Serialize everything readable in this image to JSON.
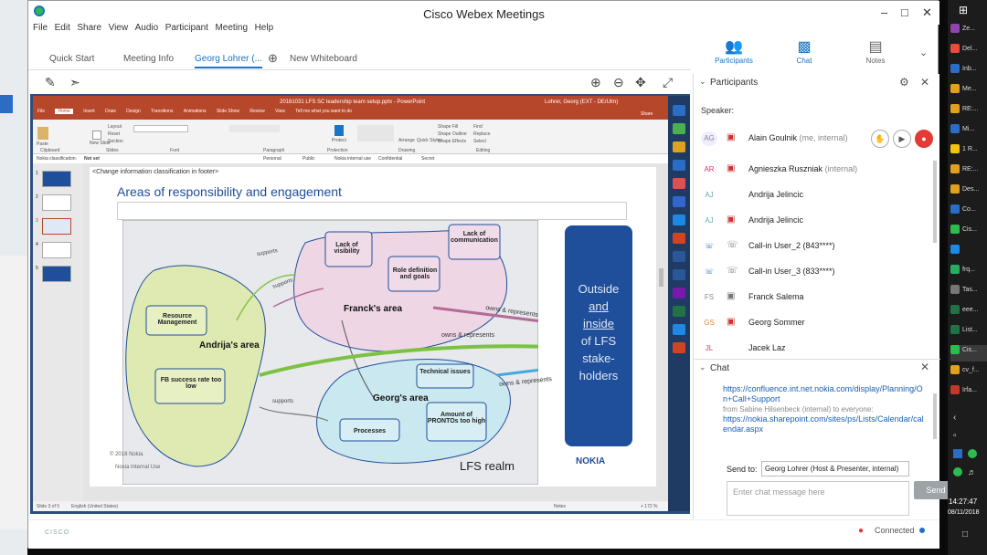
{
  "window": {
    "title": "Cisco Webex Meetings"
  },
  "menu": [
    "File",
    "Edit",
    "Share",
    "View",
    "Audio",
    "Participant",
    "Meeting",
    "Help"
  ],
  "tabs": {
    "quick_start": "Quick Start",
    "meeting_info": "Meeting Info",
    "active": "Georg Lohrer (...",
    "new_whiteboard": "New Whiteboard"
  },
  "right_tabs": {
    "participants": "Participants",
    "chat": "Chat",
    "notes": "Notes"
  },
  "ppt": {
    "title": "20181031 LFS SC leadership team setup.pptx - PowerPoint",
    "user": "Lohrer, Georg (EXT - DE/Ulm)",
    "menu": [
      "File",
      "Home",
      "Insert",
      "Draw",
      "Design",
      "Transitions",
      "Animations",
      "Slide Show",
      "Review",
      "View",
      "Tell me what you want to do"
    ],
    "share": "Share",
    "ribbon_groups": [
      "Clipboard",
      "Slides",
      "Font",
      "Paragraph",
      "Protection",
      "Drawing",
      "Editing"
    ],
    "ribbon_labels": {
      "paste": "Paste",
      "new_slide": "New Slide",
      "layout": "Layout",
      "reset": "Reset",
      "section": "Section",
      "protect": "Protect",
      "arrange": "Arrange",
      "quick_styles": "Quick Styles",
      "shape_fill": "Shape Fill",
      "shape_outline": "Shape Outline",
      "shape_effects": "Shape Effects",
      "find": "Find",
      "replace": "Replace",
      "select": "Select"
    },
    "classification_label": "Nokia classification:",
    "classification_value": "Not set",
    "classifications": [
      "Personal",
      "Public",
      "Nokia internal use",
      "Confidential",
      "Secret"
    ],
    "status_left": "Slide 3 of 5",
    "status_lang": "English (United States)",
    "status_notes": "Notes",
    "zoom": "+ 172 %"
  },
  "slide": {
    "note": "<Change information classification in footer>",
    "title": "Areas of responsibility and engagement",
    "areas": {
      "andrija": "Andrija's area",
      "franck": "Franck's area",
      "georg": "Georg's area"
    },
    "boxes": {
      "resource": "Resource Management",
      "fb": "FB success rate too low",
      "lack_vis": "Lack of visibility",
      "role": "Role definition and goals",
      "lack_comm": "Lack of communication",
      "tech": "Technical issues",
      "processes": "Processes",
      "pronto": "Amount of PRONTOs too high"
    },
    "arrows": {
      "supports1": "supports",
      "supports2": "supports",
      "supports3": "supports",
      "owns1": "owns & represents",
      "owns2": "owns & represents",
      "owns3": "owns & represents"
    },
    "realm": "LFS realm",
    "outside": [
      "Outside",
      "and",
      "inside",
      "of LFS",
      "stake-",
      "holders"
    ],
    "nokia": "NOKIA",
    "copyright": "© 2018 Nokia",
    "footer": "Nokia Internal Use"
  },
  "participants": {
    "header": "Participants",
    "speaker_label": "Speaker:",
    "list": [
      {
        "initials": "AG",
        "name": "Alain Goulnik",
        "sub": "(me, internal)"
      },
      {
        "initials": "AR",
        "name": "Agnieszka Ruszniak",
        "sub": "(internal)"
      },
      {
        "initials": "AJ",
        "name": "Andrija Jelincic",
        "sub": ""
      },
      {
        "initials": "AJ",
        "name": "Andrija Jelincic",
        "sub": ""
      },
      {
        "initials": "",
        "name": "Call-in User_2 (843****)",
        "sub": ""
      },
      {
        "initials": "",
        "name": "Call-in User_3 (833****)",
        "sub": ""
      },
      {
        "initials": "FS",
        "name": "Franck Salema",
        "sub": ""
      },
      {
        "initials": "GS",
        "name": "Georg Sommer",
        "sub": ""
      },
      {
        "initials": "JL",
        "name": "Jacek Laz",
        "sub": ""
      }
    ]
  },
  "chat": {
    "header": "Chat",
    "link1": "https://confluence.int.net.nokia.com/display/Planning/On+Call+Support",
    "from": "from Sabine Hilsenbeck (internal) to everyone:",
    "link2": "https://nokia.sharepoint.com/sites/ps/Lists/Calendar/calendar.aspx",
    "send_to_label": "Send to:",
    "send_to_value": "Georg Lohrer (Host & Presenter, internal)",
    "placeholder": "Enter chat message here",
    "send": "Send"
  },
  "status": {
    "connected": "Connected",
    "logo": "CISCO"
  },
  "taskbar": {
    "items": [
      "Ze...",
      "Del...",
      "Inb...",
      "Me...",
      "RE:...",
      "Mi...",
      "1 R...",
      "RE:...",
      "Des...",
      "Co...",
      "Cis...",
      "",
      "frq...",
      "Tas...",
      "eee...",
      "List...",
      "Cis...",
      "cv_f...",
      "Irfa..."
    ],
    "time": "14:27:47",
    "date": "08/11/2018"
  }
}
